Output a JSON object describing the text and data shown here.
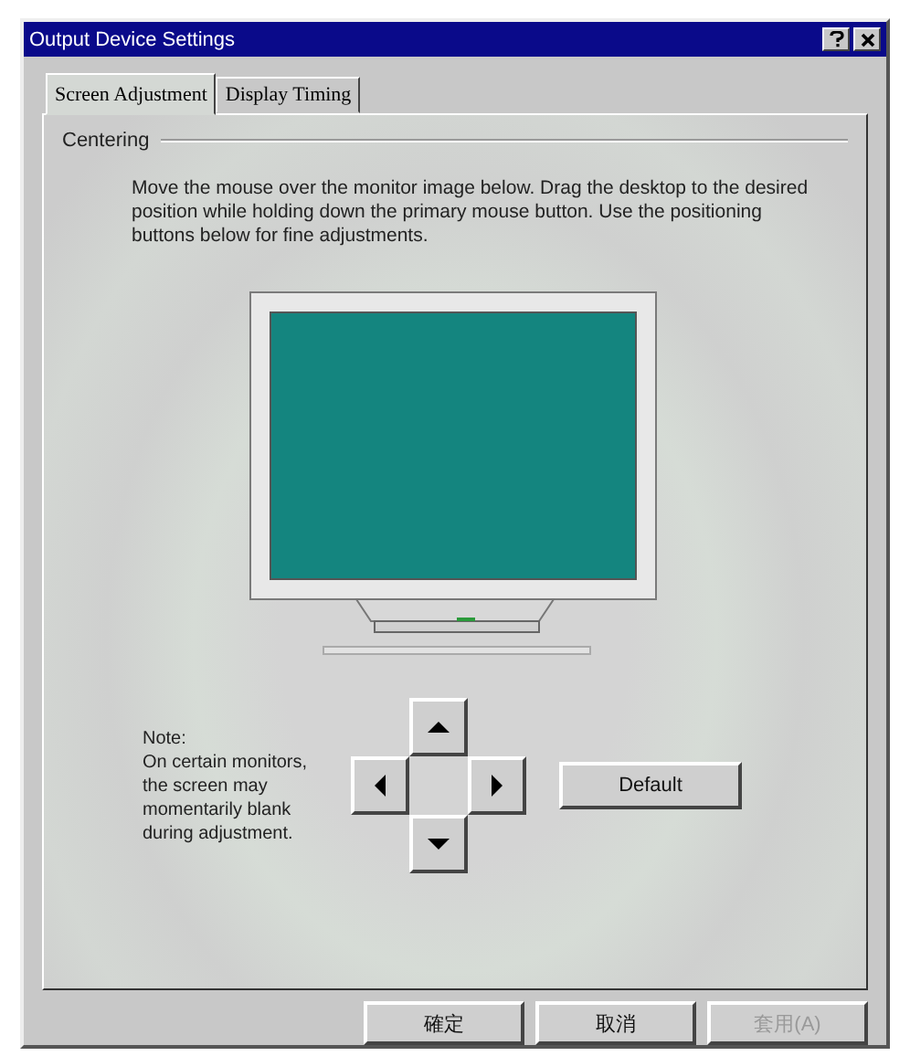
{
  "window": {
    "title": "Output Device Settings"
  },
  "tabs": [
    {
      "label": "Screen Adjustment",
      "selected": true
    },
    {
      "label": "Display Timing",
      "selected": false
    }
  ],
  "group": {
    "title": "Centering",
    "instructions": "Move the mouse over the monitor image below. Drag the desktop to the desired position while holding down the primary mouse button. Use the positioning buttons below for fine adjustments."
  },
  "note": {
    "heading": "Note:",
    "text": "On certain monitors, the screen may momentarily blank during adjustment."
  },
  "default_button": {
    "label": "Default",
    "disabled": false
  },
  "buttons": [
    {
      "label": "確定",
      "disabled": false
    },
    {
      "label": "取消",
      "disabled": false
    },
    {
      "label": "套用(A)",
      "disabled": true
    }
  ]
}
